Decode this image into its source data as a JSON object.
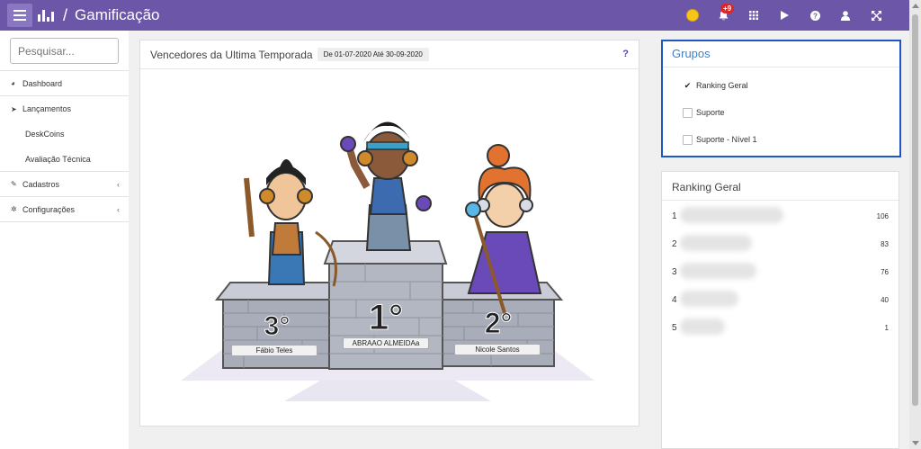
{
  "header": {
    "title": "Gamificação",
    "separator": "/",
    "notification_count": "+9",
    "accent_color": "#6b56a8"
  },
  "sidebar": {
    "search_placeholder": "Pesquisar...",
    "items": [
      {
        "label": "Dashboard",
        "icon": "dashboard-icon"
      },
      {
        "label": "Lançamentos",
        "icon": "paper-plane-icon"
      },
      {
        "label": "DeskCoins",
        "icon": ""
      },
      {
        "label": "Avaliação Técnica",
        "icon": ""
      },
      {
        "label": "Cadastros",
        "icon": "edit-icon"
      },
      {
        "label": "Configurações",
        "icon": "gear-icon"
      }
    ]
  },
  "main": {
    "title": "Vencedores da Ultima Temporada",
    "date_range": "De 01-07-2020 Até 30-09-2020",
    "help": "?",
    "podium": {
      "first": {
        "place": "1°",
        "name": "ABRAAO ALMEIDAa"
      },
      "second": {
        "place": "2°",
        "name": "Nicole Santos"
      },
      "third": {
        "place": "3°",
        "name": "Fábio Teles"
      }
    }
  },
  "grupos": {
    "title": "Grupos",
    "options": [
      {
        "label": "Ranking Geral",
        "checked": true
      },
      {
        "label": "Suporte",
        "checked": false
      },
      {
        "label": "Suporte - Nível 1",
        "checked": false
      }
    ]
  },
  "ranking": {
    "title": "Ranking Geral",
    "rows": [
      {
        "pos": "1",
        "points": "106"
      },
      {
        "pos": "2",
        "points": "83"
      },
      {
        "pos": "3",
        "points": "76"
      },
      {
        "pos": "4",
        "points": "40"
      },
      {
        "pos": "5",
        "points": "1"
      }
    ]
  }
}
